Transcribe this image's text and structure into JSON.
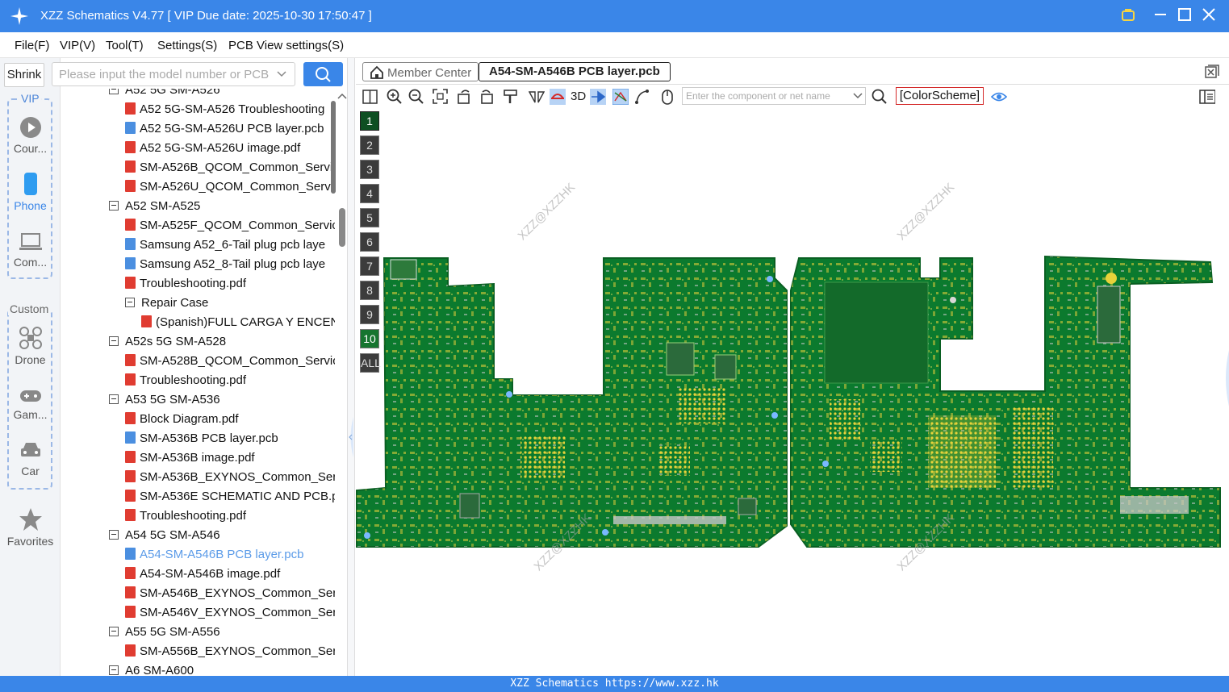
{
  "app": {
    "title": "XZZ Schematics V4.77 [ VIP Due date: 2025-10-30 17:50:47 ]",
    "accent_color": "#3a86e8"
  },
  "menu": [
    "File(F)",
    "VIP(V)",
    "Tool(T)",
    "Settings(S)",
    "PCB View settings(S)"
  ],
  "sidebar": {
    "shrink_label": "Shrink",
    "vip_label": "VIP",
    "custom_label": "Custom",
    "items": [
      {
        "label": "Cour...",
        "icon": "play-circle-icon"
      },
      {
        "label": "Phone",
        "icon": "phone-icon"
      },
      {
        "label": "Com...",
        "icon": "laptop-icon"
      },
      {
        "label": "Drone",
        "icon": "drone-icon"
      },
      {
        "label": "Gam...",
        "icon": "gamepad-icon"
      },
      {
        "label": "Car",
        "icon": "car-icon"
      },
      {
        "label": "Favorites",
        "icon": "star-icon"
      }
    ]
  },
  "search": {
    "placeholder": "Please input the model number or PCB"
  },
  "tree": [
    {
      "level": 0,
      "type": "folder",
      "label": "A52 5G SM-A526"
    },
    {
      "level": 1,
      "type": "pdf",
      "label": "A52 5G-SM-A526 Troubleshooting"
    },
    {
      "level": 1,
      "type": "pcb",
      "label": "A52 5G-SM-A526U PCB layer.pcb"
    },
    {
      "level": 1,
      "type": "pdf",
      "label": "A52 5G-SM-A526U image.pdf"
    },
    {
      "level": 1,
      "type": "pdf",
      "label": "SM-A526B_QCOM_Common_Servic"
    },
    {
      "level": 1,
      "type": "pdf",
      "label": "SM-A526U_QCOM_Common_Servic"
    },
    {
      "level": 0,
      "type": "folder",
      "label": "A52 SM-A525"
    },
    {
      "level": 1,
      "type": "pdf",
      "label": "SM-A525F_QCOM_Common_Servic"
    },
    {
      "level": 1,
      "type": "pcb",
      "label": "Samsung A52_6-Tail plug pcb laye"
    },
    {
      "level": 1,
      "type": "pcb",
      "label": "Samsung A52_8-Tail plug pcb laye"
    },
    {
      "level": 1,
      "type": "pdf",
      "label": "Troubleshooting.pdf"
    },
    {
      "level": 1,
      "type": "folder",
      "label": "Repair Case"
    },
    {
      "level": 2,
      "type": "pdf",
      "label": "(Spanish)FULL CARGA Y ENCENI"
    },
    {
      "level": 0,
      "type": "folder",
      "label": "A52s 5G SM-A528"
    },
    {
      "level": 1,
      "type": "pdf",
      "label": "SM-A528B_QCOM_Common_Servic"
    },
    {
      "level": 1,
      "type": "pdf",
      "label": "Troubleshooting.pdf"
    },
    {
      "level": 0,
      "type": "folder",
      "label": "A53 5G SM-A536"
    },
    {
      "level": 1,
      "type": "pdf",
      "label": "Block Diagram.pdf"
    },
    {
      "level": 1,
      "type": "pcb",
      "label": "SM-A536B PCB layer.pcb"
    },
    {
      "level": 1,
      "type": "pdf",
      "label": "SM-A536B image.pdf"
    },
    {
      "level": 1,
      "type": "pdf",
      "label": "SM-A536B_EXYNOS_Common_Serv"
    },
    {
      "level": 1,
      "type": "pdf",
      "label": "SM-A536E SCHEMATIC AND PCB.p"
    },
    {
      "level": 1,
      "type": "pdf",
      "label": "Troubleshooting.pdf"
    },
    {
      "level": 0,
      "type": "folder",
      "label": "A54 5G SM-A546"
    },
    {
      "level": 1,
      "type": "pcb",
      "label": "A54-SM-A546B PCB layer.pcb",
      "active": true
    },
    {
      "level": 1,
      "type": "pdf",
      "label": "A54-SM-A546B image.pdf"
    },
    {
      "level": 1,
      "type": "pdf",
      "label": "SM-A546B_EXYNOS_Common_Serv"
    },
    {
      "level": 1,
      "type": "pdf",
      "label": "SM-A546V_EXYNOS_Common_Serv"
    },
    {
      "level": 0,
      "type": "folder",
      "label": "A55 5G SM-A556"
    },
    {
      "level": 1,
      "type": "pdf",
      "label": "SM-A556B_EXYNOS_Common_Serv"
    },
    {
      "level": 0,
      "type": "folder",
      "label": "A6 SM-A600"
    }
  ],
  "tabs": [
    {
      "label": "Member Center",
      "icon": "home-icon"
    },
    {
      "label": "A54-SM-A546B PCB layer.pcb",
      "active": true
    }
  ],
  "toolbar": {
    "three_d_label": "3D",
    "component_search_placeholder": "Enter the component or net name",
    "color_scheme_label": "[ColorScheme]"
  },
  "layers": [
    "1",
    "2",
    "3",
    "4",
    "5",
    "6",
    "7",
    "8",
    "9",
    "10",
    "ALL"
  ],
  "watermark": "XZZ@XZZHK",
  "statusbar": "XZZ Schematics https://www.xzz.hk"
}
